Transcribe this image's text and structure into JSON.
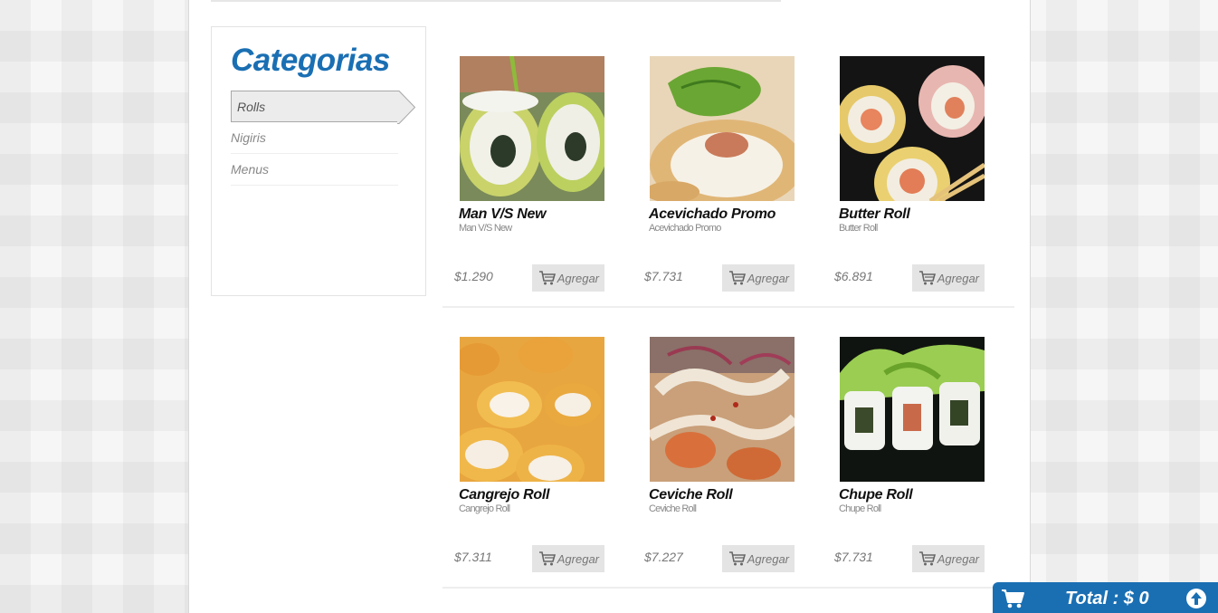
{
  "sidebar": {
    "title": "Categorias",
    "items": [
      {
        "label": "Rolls",
        "active": true
      },
      {
        "label": "Nigiris",
        "active": false
      },
      {
        "label": "Menus",
        "active": false
      }
    ]
  },
  "products": [
    {
      "name": "Man V/S New",
      "sub": "Man V/S New",
      "price": "$1.290",
      "add_label": "Agregar"
    },
    {
      "name": "Acevichado Promo",
      "sub": "Acevichado Promo",
      "price": "$7.731",
      "add_label": "Agregar"
    },
    {
      "name": "Butter Roll",
      "sub": "Butter Roll",
      "price": "$6.891",
      "add_label": "Agregar"
    },
    {
      "name": "Cangrejo Roll",
      "sub": "Cangrejo Roll",
      "price": "$7.311",
      "add_label": "Agregar"
    },
    {
      "name": "Ceviche Roll",
      "sub": "Ceviche Roll",
      "price": "$7.227",
      "add_label": "Agregar"
    },
    {
      "name": "Chupe Roll",
      "sub": "Chupe Roll",
      "price": "$7.731",
      "add_label": "Agregar"
    }
  ],
  "cart": {
    "total": "Total : $ 0"
  },
  "colors": {
    "accent": "#1a6fb3",
    "button_bg": "#e4e4e4"
  }
}
